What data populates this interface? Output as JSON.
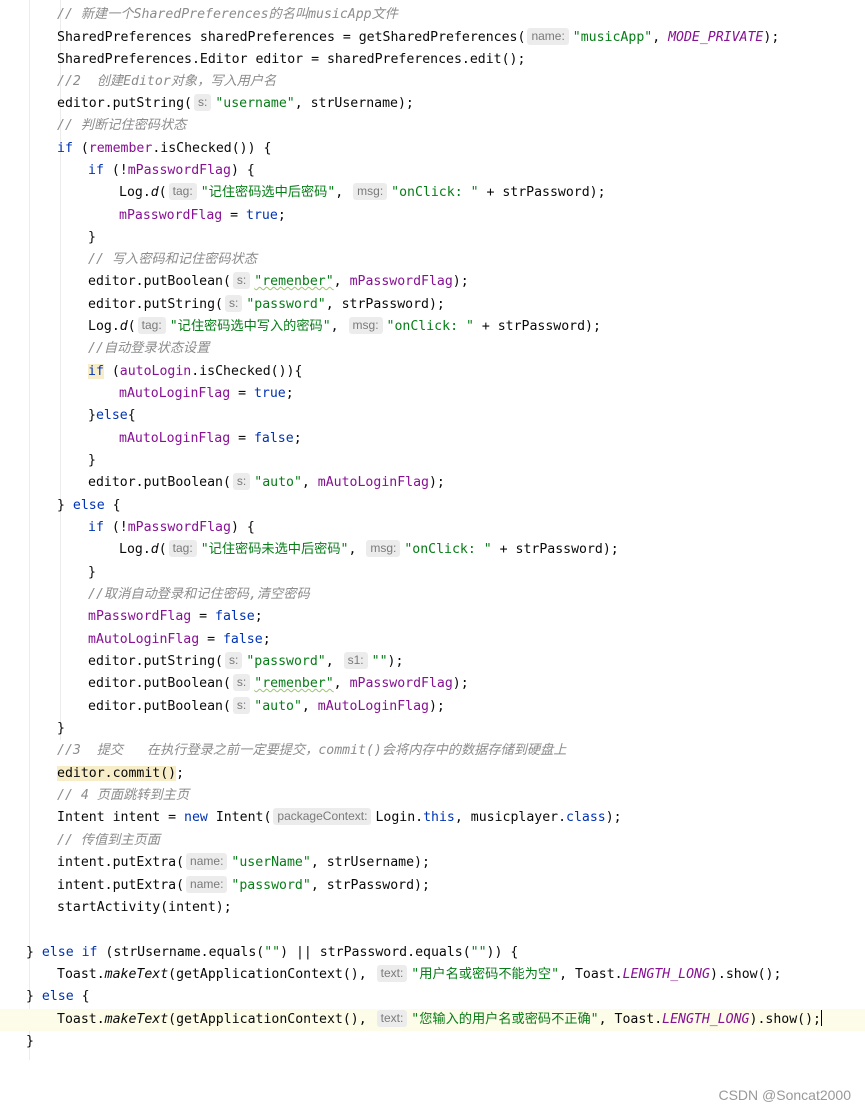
{
  "code": {
    "comment_create": "// 新建一个SharedPreferences的名叫musicApp文件",
    "hint_name": "name:",
    "hint_s": "s:",
    "hint_s1": "s1:",
    "hint_tag": "tag:",
    "hint_msg": "msg:",
    "hint_text": "text:",
    "hint_package_context": "packageContext:",
    "comment_step2": "//2  创建Editor对象，写入用户名",
    "comment_check_remember": "// 判断记住密码状态",
    "comment_write_pwd": "// 写入密码和记住密码状态",
    "comment_auto_login": "//自动登录状态设置",
    "comment_cancel": "//取消自动登录和记住密码,清空密码",
    "comment_step3": "//3  提交   在执行登录之前一定要提交，commit()会将内存中的数据存储到硬盘上",
    "comment_step4": "// 4 页面跳转到主页",
    "comment_pass_values": "// 传值到主页面",
    "str_music_app": "\"musicApp\"",
    "str_username_key": "\"username\"",
    "str_log_remember_checked": "\"记住密码选中后密码\"",
    "str_onclick": "\"onClick: \"",
    "str_remenber": "\"remenber\"",
    "str_password": "\"password\"",
    "str_log_remember_write": "\"记住密码选中写入的密码\"",
    "str_auto": "\"auto\"",
    "str_log_remember_unchecked": "\"记住密码未选中后密码\"",
    "str_empty": "\"\"",
    "str_username_extra": "\"userName\"",
    "str_toast_empty": "\"用户名或密码不能为空\"",
    "str_toast_wrong": "\"您输入的用户名或密码不正确\""
  },
  "watermark": "CSDN @Soncat2000"
}
